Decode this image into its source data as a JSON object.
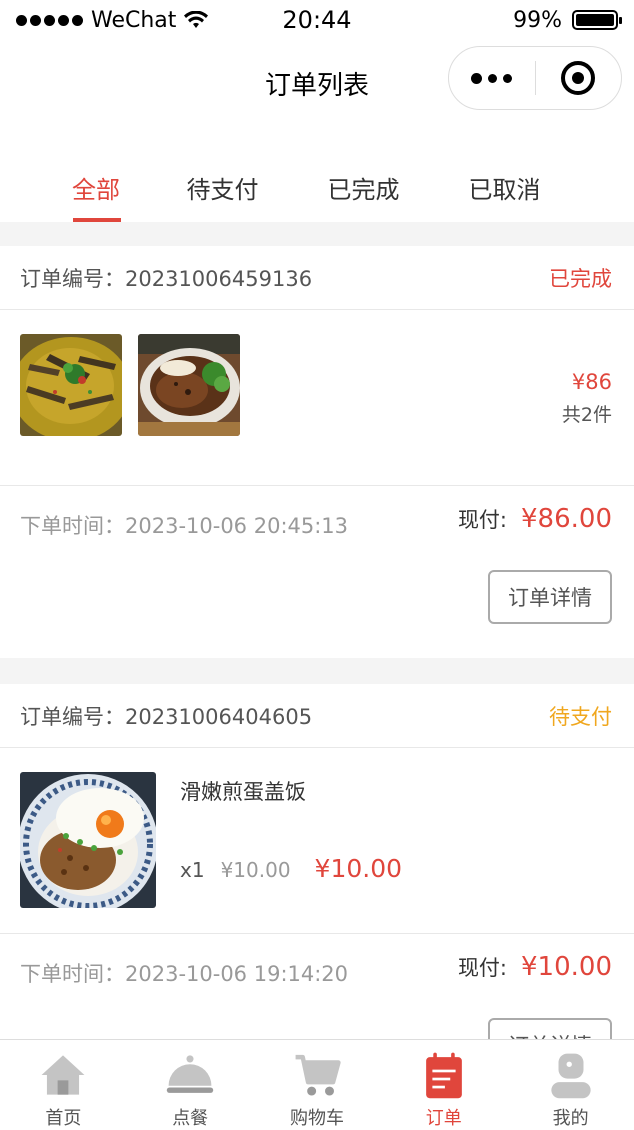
{
  "status_bar": {
    "carrier": "WeChat",
    "time": "20:44",
    "battery": "99%"
  },
  "nav": {
    "title": "订单列表"
  },
  "tabs": [
    {
      "label": "全部",
      "active": true
    },
    {
      "label": "待支付",
      "active": false
    },
    {
      "label": "已完成",
      "active": false
    },
    {
      "label": "已取消",
      "active": false
    }
  ],
  "orders": [
    {
      "order_no_label": "订单编号：",
      "order_no": "20231006459136",
      "status": "已完成",
      "thumbnails": [
        "braised-fish-dish",
        "beef-rice-bowl"
      ],
      "total_price": "¥86",
      "item_count": "共2件",
      "time_label": "下单时间：",
      "time": "2023-10-06 20:45:13",
      "paid_label": "现付:",
      "paid": "¥86.00",
      "detail_button": "订单详情"
    },
    {
      "order_no_label": "订单编号：",
      "order_no": "20231006404605",
      "status": "待支付",
      "item_name": "滑嫩煎蛋盖饭",
      "quantity": "x1",
      "unit_price": "¥10.00",
      "item_price": "¥10.00",
      "time_label": "下单时间：",
      "time": "2023-10-06 19:14:20",
      "paid_label": "现付:",
      "paid": "¥10.00",
      "detail_button": "订单详情"
    }
  ],
  "tabbar": [
    {
      "label": "首页",
      "icon": "home-icon",
      "active": false
    },
    {
      "label": "点餐",
      "icon": "food-cloche-icon",
      "active": false
    },
    {
      "label": "购物车",
      "icon": "cart-icon",
      "active": false
    },
    {
      "label": "订单",
      "icon": "order-list-icon",
      "active": true
    },
    {
      "label": "我的",
      "icon": "user-icon",
      "active": false
    }
  ],
  "colors": {
    "accent": "#e0463c",
    "pending": "#f0a71e"
  }
}
